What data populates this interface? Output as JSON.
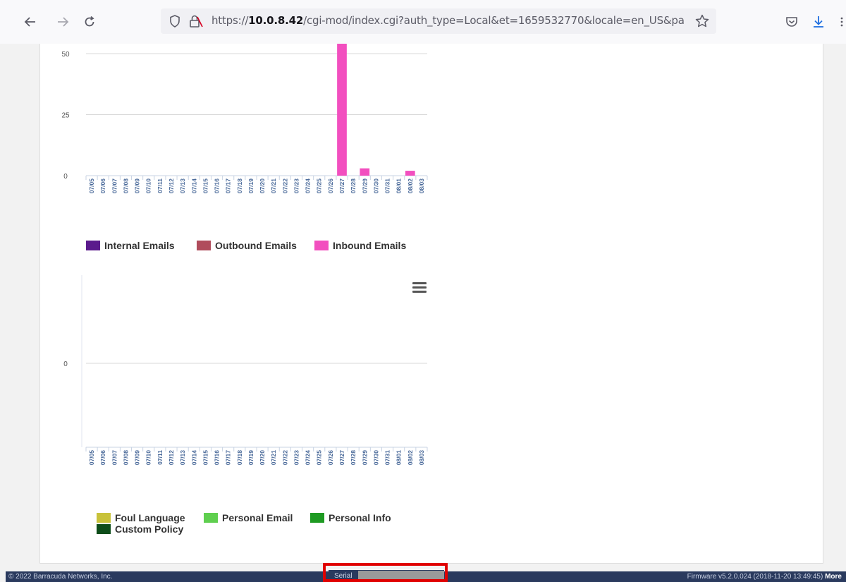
{
  "browser": {
    "url_prefix": "https://",
    "url_host": "10.0.8.42",
    "url_rest": "/cgi-mod/index.cgi?auth_type=Local&et=1659532770&locale=en_US&pa",
    "icons": [
      "back-arrow-icon",
      "forward-arrow-icon",
      "reload-icon",
      "shield-icon",
      "lock-icon",
      "star-icon",
      "pocket-icon",
      "download-icon"
    ]
  },
  "chart_data": [
    {
      "type": "bar",
      "x": [
        "07/05",
        "07/06",
        "07/07",
        "07/08",
        "07/09",
        "07/10",
        "07/11",
        "07/12",
        "07/13",
        "07/14",
        "07/15",
        "07/16",
        "07/17",
        "07/18",
        "07/19",
        "07/20",
        "07/21",
        "07/22",
        "07/23",
        "07/24",
        "07/25",
        "07/26",
        "07/27",
        "07/28",
        "07/29",
        "07/30",
        "07/31",
        "08/01",
        "08/02",
        "08/03"
      ],
      "series": [
        {
          "name": "Internal Emails",
          "color": "#5a1a8c",
          "values": [
            0,
            0,
            0,
            0,
            0,
            0,
            0,
            0,
            0,
            0,
            0,
            0,
            0,
            0,
            0,
            0,
            0,
            0,
            0,
            0,
            0,
            0,
            0,
            0,
            0,
            0,
            0,
            0,
            0,
            0
          ]
        },
        {
          "name": "Outbound Emails",
          "color": "#b04c5c",
          "values": [
            0,
            0,
            0,
            0,
            0,
            0,
            0,
            0,
            0,
            0,
            0,
            0,
            0,
            0,
            0,
            0,
            0,
            0,
            0,
            0,
            0,
            0,
            0,
            0,
            0,
            0,
            0,
            0,
            0,
            0
          ]
        },
        {
          "name": "Inbound Emails",
          "color": "#f24fbf",
          "values": [
            0,
            0,
            0,
            0,
            0,
            0,
            0,
            0,
            0,
            0,
            0,
            0,
            0,
            0,
            0,
            0,
            0,
            0,
            0,
            0,
            0,
            0,
            58,
            0,
            3,
            0,
            0,
            0,
            2,
            0
          ]
        }
      ],
      "yticks": [
        0,
        25,
        50
      ],
      "ylim": [
        0,
        57
      ],
      "grid": true,
      "legend_placement": "bottom"
    },
    {
      "type": "bar",
      "x": [
        "07/05",
        "07/06",
        "07/07",
        "07/08",
        "07/09",
        "07/10",
        "07/11",
        "07/12",
        "07/13",
        "07/14",
        "07/15",
        "07/16",
        "07/17",
        "07/18",
        "07/19",
        "07/20",
        "07/21",
        "07/22",
        "07/23",
        "07/24",
        "07/25",
        "07/26",
        "07/27",
        "07/28",
        "07/29",
        "07/30",
        "07/31",
        "08/01",
        "08/02",
        "08/03"
      ],
      "series": [
        {
          "name": "Foul Language",
          "color": "#c8c23a",
          "values": [
            0,
            0,
            0,
            0,
            0,
            0,
            0,
            0,
            0,
            0,
            0,
            0,
            0,
            0,
            0,
            0,
            0,
            0,
            0,
            0,
            0,
            0,
            0,
            0,
            0,
            0,
            0,
            0,
            0,
            0
          ]
        },
        {
          "name": "Personal Email",
          "color": "#5fcf4f",
          "values": [
            0,
            0,
            0,
            0,
            0,
            0,
            0,
            0,
            0,
            0,
            0,
            0,
            0,
            0,
            0,
            0,
            0,
            0,
            0,
            0,
            0,
            0,
            0,
            0,
            0,
            0,
            0,
            0,
            0,
            0
          ]
        },
        {
          "name": "Personal Info",
          "color": "#1e9a22",
          "values": [
            0,
            0,
            0,
            0,
            0,
            0,
            0,
            0,
            0,
            0,
            0,
            0,
            0,
            0,
            0,
            0,
            0,
            0,
            0,
            0,
            0,
            0,
            0,
            0,
            0,
            0,
            0,
            0,
            0,
            0
          ]
        },
        {
          "name": "Custom Policy",
          "color": "#0d4d1a",
          "values": [
            0,
            0,
            0,
            0,
            0,
            0,
            0,
            0,
            0,
            0,
            0,
            0,
            0,
            0,
            0,
            0,
            0,
            0,
            0,
            0,
            0,
            0,
            0,
            0,
            0,
            0,
            0,
            0,
            0,
            0
          ]
        }
      ],
      "yticks": [
        0
      ],
      "grid": true,
      "legend_placement": "bottom",
      "menu_icon": "hamburger-menu-icon"
    }
  ],
  "footer": {
    "copyright": "© 2022 Barracuda Networks, Inc.",
    "serial_label": "Serial",
    "firmware": "Firmware v5.2.0.024 (2018-11-20 13:49:45)",
    "more": "More"
  }
}
